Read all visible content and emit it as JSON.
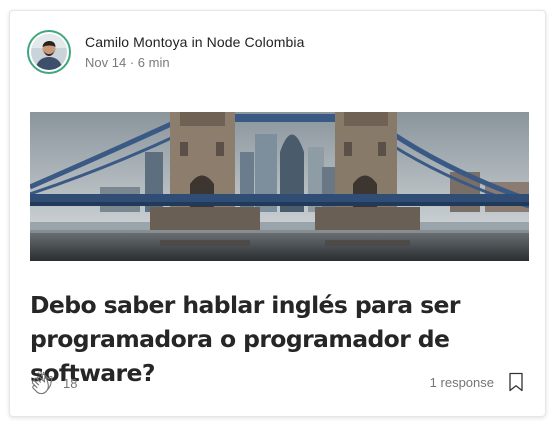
{
  "post": {
    "author": "Camilo Montoya",
    "in_word": "in",
    "publication": "Node Colombia",
    "date": "Nov 14",
    "separator": "·",
    "read_time": "6 min",
    "title": "Debo saber hablar inglés para ser programadora o programador de software?",
    "image_alt": "Tower Bridge, London",
    "claps": "18",
    "responses": "1 response"
  },
  "icons": {
    "clap": "clap-icon",
    "bookmark": "bookmark-icon"
  },
  "colors": {
    "avatar_ring": "#3fa77c",
    "text_primary": "#262626",
    "text_muted": "#757575",
    "card_border": "#e6e6e6"
  }
}
